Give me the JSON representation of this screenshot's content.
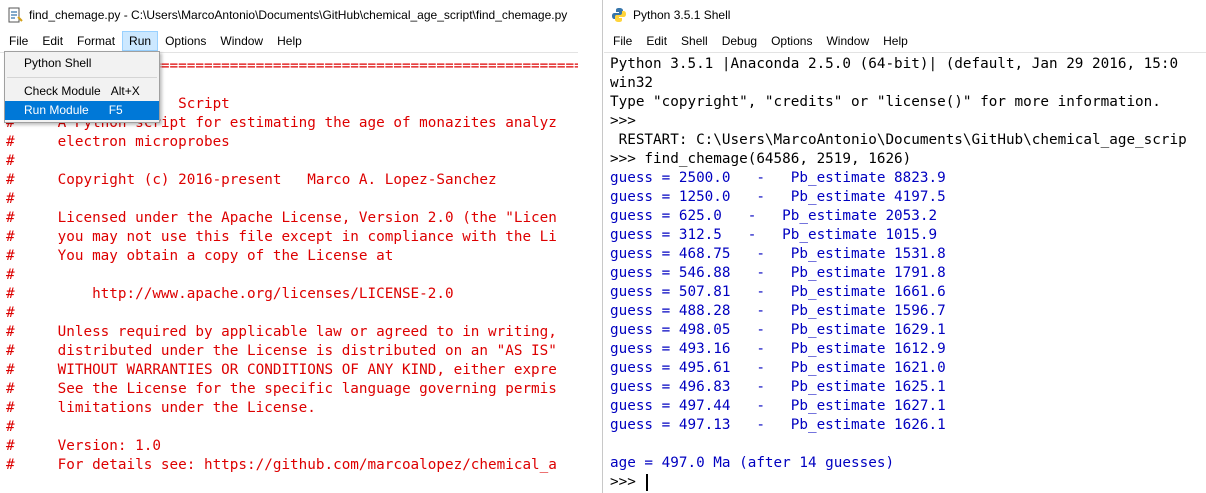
{
  "editor": {
    "title": "find_chemage.py - C:\\Users\\MarcoAntonio\\Documents\\GitHub\\chemical_age_script\\find_chemage.py",
    "menu": [
      "File",
      "Edit",
      "Format",
      "Run",
      "Options",
      "Window",
      "Help"
    ],
    "active_menu": "Run",
    "run_menu": {
      "items": [
        {
          "label": "Python Shell",
          "accel": ""
        },
        {
          "label": "Check Module",
          "accel": "Alt+X"
        },
        {
          "label": "Run Module",
          "accel": "F5"
        }
      ]
    },
    "lines": [
      "#  ================================================================",
      "#",
      "#                   Script",
      "#     A Python script for estimating the age of monazites analyz",
      "#     electron microprobes",
      "#",
      "#     Copyright (c) 2016-present   Marco A. Lopez-Sanchez",
      "#",
      "#     Licensed under the Apache License, Version 2.0 (the \"Licen",
      "#     you may not use this file except in compliance with the Li",
      "#     You may obtain a copy of the License at",
      "#",
      "#         http://www.apache.org/licenses/LICENSE-2.0",
      "#",
      "#     Unless required by applicable law or agreed to in writing,",
      "#     distributed under the License is distributed on an \"AS IS\"",
      "#     WITHOUT WARRANTIES OR CONDITIONS OF ANY KIND, either expre",
      "#     See the License for the specific language governing permis",
      "#     limitations under the License.",
      "#",
      "#     Version: 1.0",
      "#     For details see: https://github.com/marcoalopez/chemical_a"
    ]
  },
  "shell": {
    "title": "Python 3.5.1 Shell",
    "menu": [
      "File",
      "Edit",
      "Shell",
      "Debug",
      "Options",
      "Window",
      "Help"
    ],
    "banner": [
      "Python 3.5.1 |Anaconda 2.5.0 (64-bit)| (default, Jan 29 2016, 15:0",
      "win32",
      "Type \"copyright\", \"credits\" or \"license()\" for more information."
    ],
    "prompt": ">>>",
    "restart_line": " RESTART: C:\\Users\\MarcoAntonio\\Documents\\GitHub\\chemical_age_scrip",
    "command": ">>> find_chemage(64586, 2519, 1626)",
    "output": [
      "guess = 2500.0   -   Pb_estimate 8823.9",
      "guess = 1250.0   -   Pb_estimate 4197.5",
      "guess = 625.0   -   Pb_estimate 2053.2",
      "guess = 312.5   -   Pb_estimate 1015.9",
      "guess = 468.75   -   Pb_estimate 1531.8",
      "guess = 546.88   -   Pb_estimate 1791.8",
      "guess = 507.81   -   Pb_estimate 1661.6",
      "guess = 488.28   -   Pb_estimate 1596.7",
      "guess = 498.05   -   Pb_estimate 1629.1",
      "guess = 493.16   -   Pb_estimate 1612.9",
      "guess = 495.61   -   Pb_estimate 1621.0",
      "guess = 496.83   -   Pb_estimate 1625.1",
      "guess = 497.44   -   Pb_estimate 1627.1",
      "guess = 497.13   -   Pb_estimate 1626.1"
    ],
    "result": "age = 497.0 Ma (after 14 guesses)",
    "final_prompt": ">>> "
  },
  "colors": {
    "comment": "#dd0000",
    "stdout": "#0000c0",
    "highlight": "#0078d7",
    "menu_active": "#cce8ff"
  }
}
